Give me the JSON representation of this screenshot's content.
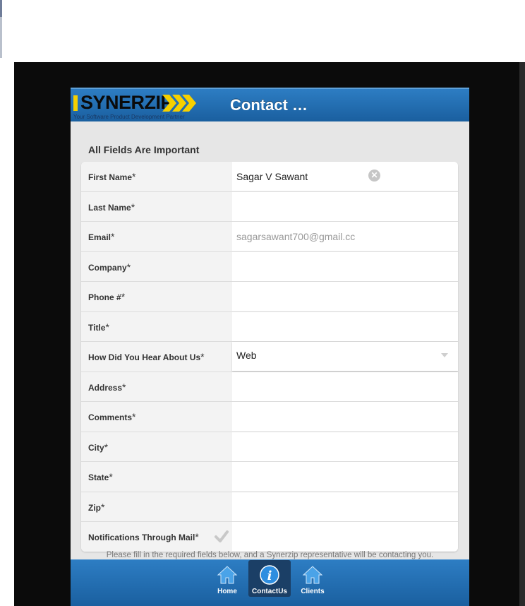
{
  "app": {
    "logo_text": "SYNERZIP",
    "logo_tagline": "Your Software Product Development Partner",
    "title": "Contact …"
  },
  "form": {
    "heading": "All Fields Are Important",
    "required_mark": "*",
    "fields": {
      "first_name": {
        "label": "First Name",
        "value": "Sagar V Sawant"
      },
      "last_name": {
        "label": "Last Name",
        "value": ""
      },
      "email": {
        "label": "Email",
        "value": "sagarsawant700@gmail.cc"
      },
      "company": {
        "label": "Company",
        "value": ""
      },
      "phone": {
        "label": "Phone #",
        "value": ""
      },
      "title": {
        "label": "Title",
        "value": ""
      },
      "how_heard": {
        "label": "How Did You Hear About Us",
        "value": "Web"
      },
      "address": {
        "label": "Address",
        "value": ""
      },
      "comments": {
        "label": "Comments",
        "value": ""
      },
      "city": {
        "label": "City",
        "value": ""
      },
      "state": {
        "label": "State",
        "value": ""
      },
      "zip": {
        "label": "Zip",
        "value": ""
      },
      "notifications": {
        "label": "Notifications Through Mail",
        "checked": true
      }
    },
    "notice": "Please fill in the required fields below, and a Synerzip representative will be contacting you."
  },
  "tabs": [
    {
      "label": "Home",
      "icon": "home-icon",
      "active": false
    },
    {
      "label": "ContactUs",
      "icon": "info-icon",
      "active": true
    },
    {
      "label": "Clients",
      "icon": "home-icon",
      "active": false
    }
  ],
  "colors": {
    "header_blue": "#2d7dc3",
    "logo_yellow": "#f6d000",
    "active_tab": "#1b3f66"
  }
}
